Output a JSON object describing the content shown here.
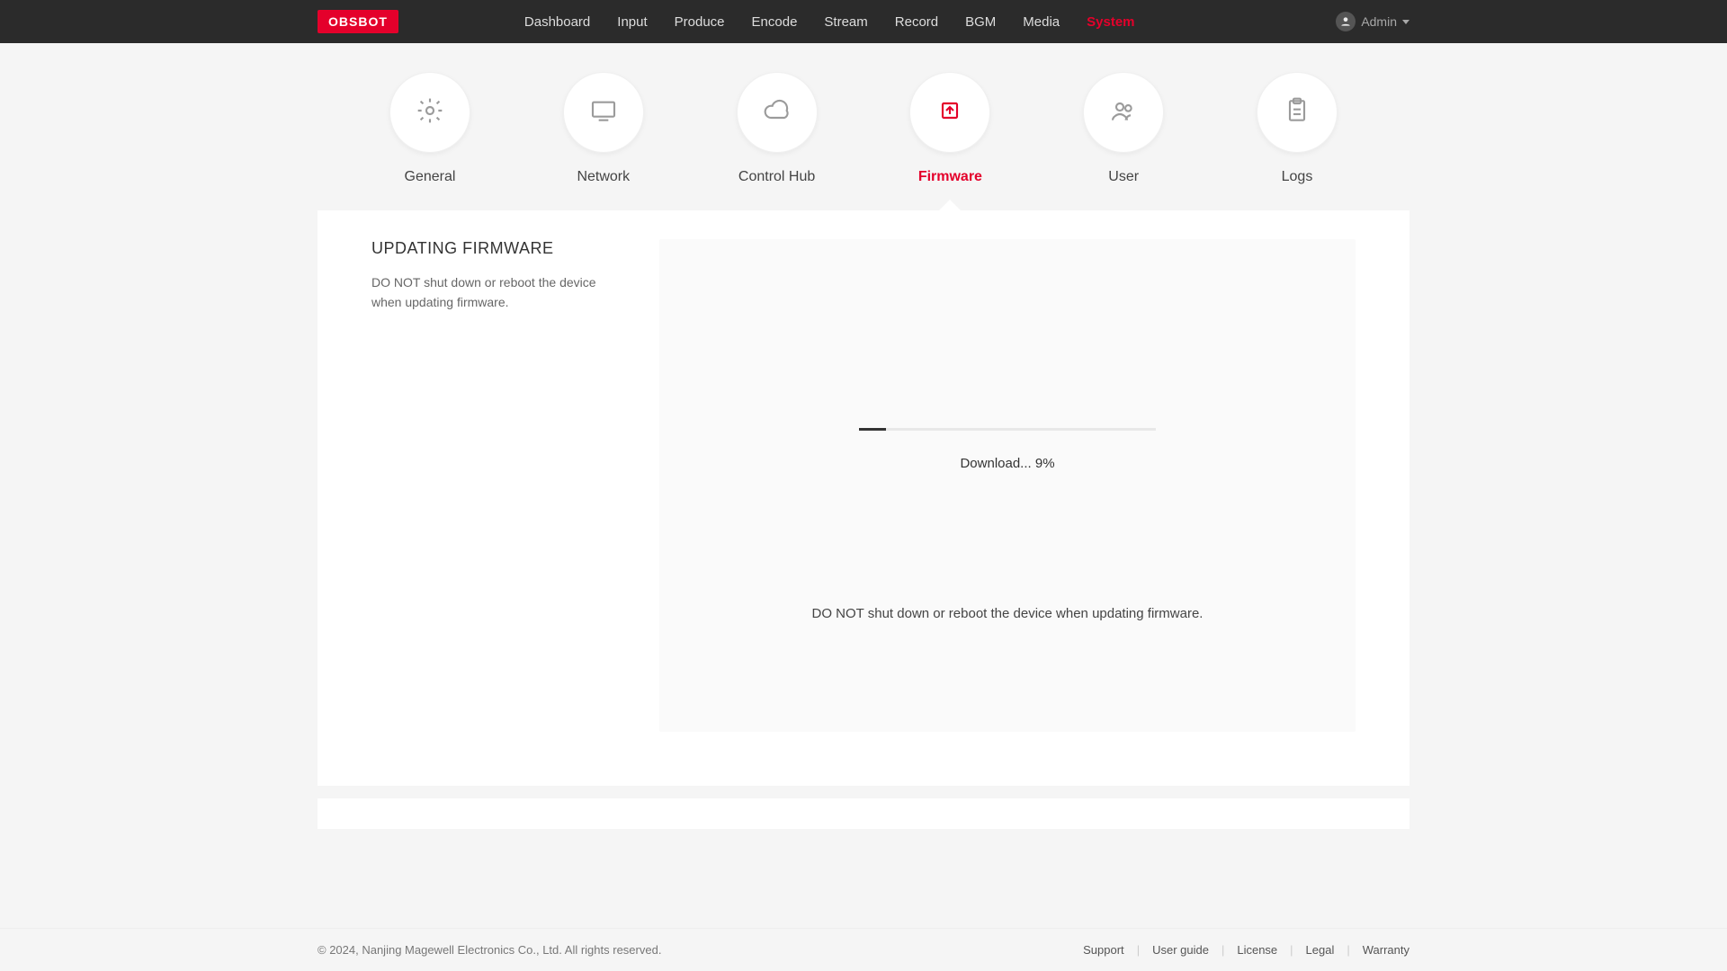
{
  "brand": "OBSBOT",
  "nav": [
    {
      "label": "Dashboard",
      "active": false
    },
    {
      "label": "Input",
      "active": false
    },
    {
      "label": "Produce",
      "active": false
    },
    {
      "label": "Encode",
      "active": false
    },
    {
      "label": "Stream",
      "active": false
    },
    {
      "label": "Record",
      "active": false
    },
    {
      "label": "BGM",
      "active": false
    },
    {
      "label": "Media",
      "active": false
    },
    {
      "label": "System",
      "active": true
    }
  ],
  "user": {
    "name": "Admin"
  },
  "subtabs": [
    {
      "label": "General",
      "icon": "gear",
      "active": false
    },
    {
      "label": "Network",
      "icon": "monitor",
      "active": false
    },
    {
      "label": "Control Hub",
      "icon": "cloud",
      "active": false
    },
    {
      "label": "Firmware",
      "icon": "chip",
      "active": true
    },
    {
      "label": "User",
      "icon": "users",
      "active": false
    },
    {
      "label": "Logs",
      "icon": "clipboard",
      "active": false
    }
  ],
  "panel": {
    "title": "UPDATING FIRMWARE",
    "subtitle": "DO NOT shut down or reboot the device when updating firmware.",
    "download_label": "Download... 9%",
    "progress_pct": 9,
    "warning": "DO NOT shut down or reboot the device when updating firmware."
  },
  "footer": {
    "copyright": "© 2024, Nanjing Magewell Electronics Co., Ltd. All rights reserved.",
    "links": [
      "Support",
      "User guide",
      "License",
      "Legal",
      "Warranty"
    ]
  }
}
